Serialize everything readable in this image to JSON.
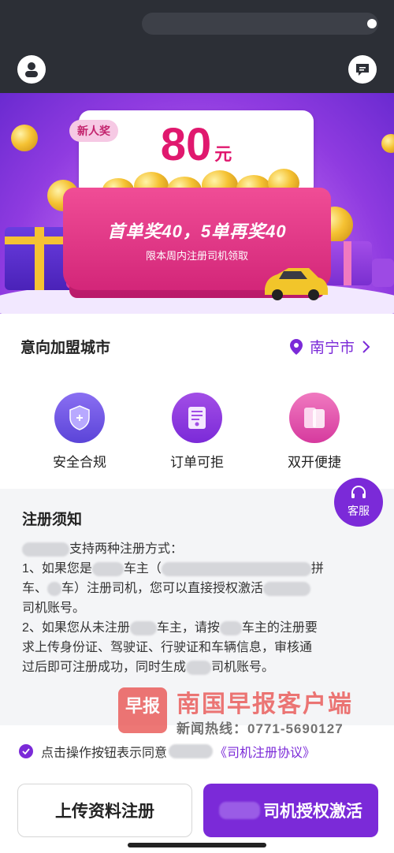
{
  "banner": {
    "badge": "新人奖",
    "amount": "80",
    "unit": "元",
    "slogan": "首单奖40，5单再奖40",
    "sub_slogan": "限本周内注册司机领取"
  },
  "city": {
    "title": "意向加盟城市",
    "value": "南宁市"
  },
  "features": [
    {
      "label": "安全合规",
      "icon": "shield-icon"
    },
    {
      "label": "订单可拒",
      "icon": "document-icon"
    },
    {
      "label": "双开便捷",
      "icon": "dual-phone-icon"
    }
  ],
  "service": {
    "label": "客服"
  },
  "notice": {
    "title": "注册须知",
    "line1_suffix": "支持两种注册方式：",
    "line2_a": "1、如果您是",
    "line2_b": "车主（",
    "line2_c": "拼",
    "line3_a": "车、",
    "line3_b": "车）注册司机，您可以直接授权激活",
    "line4": "司机账号。",
    "line5_a": "2、如果您从未注册",
    "line5_b": "车主，请按",
    "line5_c": "车主的注册要",
    "line6": "求上传身份证、驾驶证、行驶证和车辆信息，审核通",
    "line7_a": "过后即可注册成功，同时生成",
    "line7_b": "司机账号。"
  },
  "watermark": {
    "logo": "早报",
    "title": "南国早报客户端",
    "phone": "新闻热线：0771-5690127"
  },
  "agreement": {
    "text": "点击操作按钮表示同意",
    "link": "《司机注册协议》"
  },
  "buttons": {
    "upload": "上传资料注册",
    "activate_suffix": "司机授权激活"
  },
  "colors": {
    "accent": "#7b2ad8",
    "banner_pink": "#e0186e"
  }
}
